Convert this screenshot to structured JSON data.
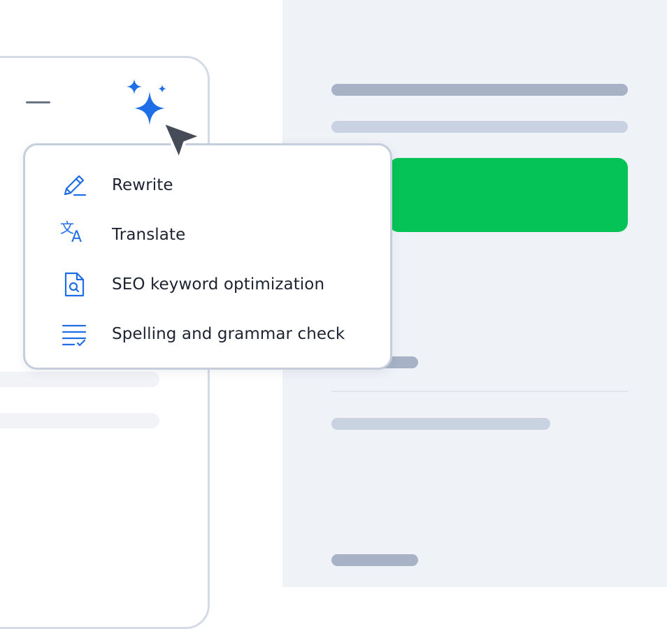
{
  "ai_menu": {
    "items": [
      {
        "label": "Rewrite",
        "icon": "pencil-icon"
      },
      {
        "label": "Translate",
        "icon": "translate-icon"
      },
      {
        "label": "SEO keyword optimization",
        "icon": "document-search-icon"
      },
      {
        "label": "Spelling and grammar check",
        "icon": "text-check-icon"
      }
    ]
  },
  "colors": {
    "accent": "#1f6ee8",
    "green_block": "#06c357",
    "right_pane_bg": "#eff2f7"
  },
  "icons": {
    "ai_button": "sparkle-icon",
    "cursor": "mouse-pointer-icon",
    "minimize": "minimize-icon"
  }
}
